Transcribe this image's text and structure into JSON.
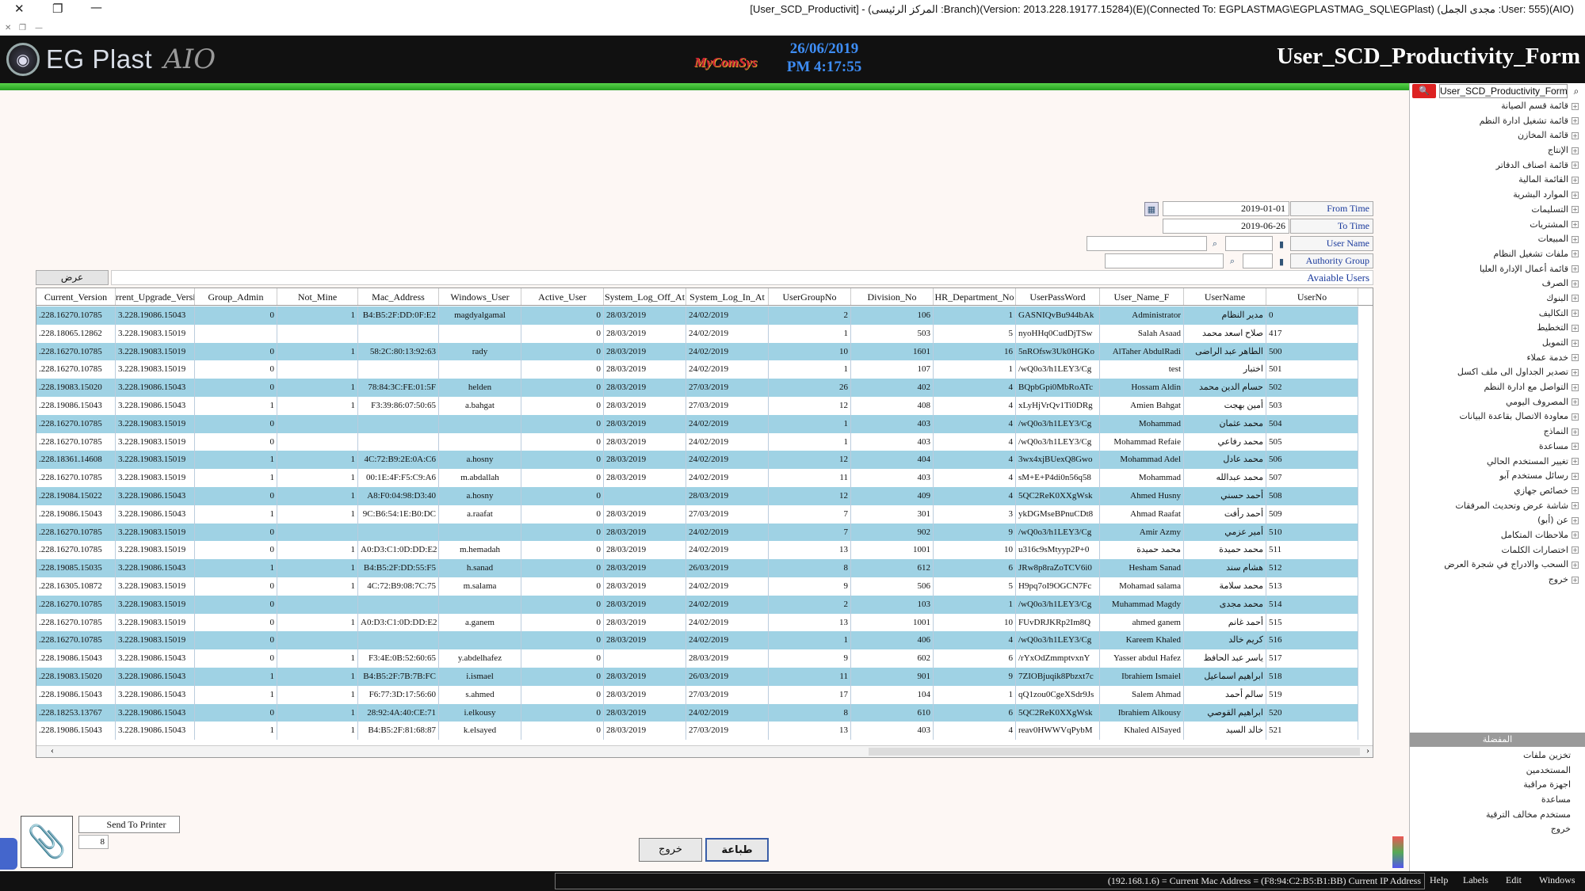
{
  "window": {
    "title": "[User_SCD_Productivit] - (المركز الرئيسى :Branch)(Version: 2013.228.19177.15284)(E)(Connected To: EGPLASTMAG\\EGPLASTMAG_SQL\\EGPlast) (مجدى الجمل :User: 555)(AIO)",
    "close": "✕",
    "restore": "❐",
    "minimize": "—"
  },
  "header": {
    "logo_text": "EG Plast",
    "logo_suffix": "AIO",
    "logo_mark": "◉",
    "brand": "MyComSys",
    "date": "26/06/2019",
    "time": "PM 4:17:55",
    "form_title": "User_SCD_Productivity_Form"
  },
  "filters": {
    "from_label": "From Time",
    "from_value": "2019-01-01",
    "to_label": "To Time",
    "to_value": "2019-06-26",
    "user_label": "User Name",
    "group_label": "Authority Group",
    "available_label": "Avaiable Users",
    "show_button": "عرض"
  },
  "grid": {
    "columns": [
      "Current_Version",
      "rrent_Upgrade_Versi",
      "Group_Admin",
      "Not_Mine",
      "Mac_Address",
      "Windows_User",
      "Active_User",
      "System_Log_Off_At",
      "System_Log_In_At",
      "UserGroupNo",
      "Division_No",
      "HR_Department_No",
      "UserPassWord",
      "User_Name_F",
      "UserName",
      "UserNo"
    ],
    "rows": [
      [
        ".228.16270.10785",
        "3.228.19086.15043",
        "0",
        "1",
        "B4:B5:2F:DD:0F:E2",
        "magdyalgamal",
        "0",
        "28/03/2019",
        "24/02/2019",
        "2",
        "106",
        "1",
        "GASNIQvBu944bAk",
        "Administrator",
        "مدير النظام",
        "0"
      ],
      [
        ".228.18065.12862",
        "3.228.19083.15019",
        "",
        "",
        "",
        "",
        "0",
        "28/03/2019",
        "24/02/2019",
        "1",
        "503",
        "5",
        "nyoHHq0CudDjTSw",
        "Salah Asaad",
        "صلاح اسعد محمد",
        "417"
      ],
      [
        ".228.16270.10785",
        "3.228.19083.15019",
        "0",
        "1",
        "58:2C:80:13:92:63",
        "rady",
        "0",
        "28/03/2019",
        "24/02/2019",
        "10",
        "1601",
        "16",
        "5nROfsw3Uk0HGKo",
        "AlTaher AbdulRadi",
        "الطاهر عبد الراضى",
        "500"
      ],
      [
        ".228.16270.10785",
        "3.228.19083.15019",
        "0",
        "",
        "",
        "",
        "0",
        "28/03/2019",
        "24/02/2019",
        "1",
        "107",
        "1",
        "/wQ0o3/h1LEY3/Cg",
        "test",
        "اختبار",
        "501"
      ],
      [
        ".228.19083.15020",
        "3.228.19086.15043",
        "0",
        "1",
        "78:84:3C:FE:01:5F",
        "helden",
        "0",
        "28/03/2019",
        "27/03/2019",
        "26",
        "402",
        "4",
        "BQpbGpi0MbRoATc",
        "Hossam Aldin",
        "حسام الدين محمد",
        "502"
      ],
      [
        ".228.19086.15043",
        "3.228.19086.15043",
        "1",
        "1",
        "F3:39:86:07:50:65",
        "a.bahgat",
        "0",
        "28/03/2019",
        "27/03/2019",
        "12",
        "408",
        "4",
        "xLyHjVrQv1Ti0DRg",
        "Amien Bahgat",
        "أمين بهجت",
        "503"
      ],
      [
        ".228.16270.10785",
        "3.228.19083.15019",
        "0",
        "",
        "",
        "",
        "0",
        "28/03/2019",
        "24/02/2019",
        "1",
        "403",
        "4",
        "/wQ0o3/h1LEY3/Cg",
        "Mohammad",
        "محمد عثمان",
        "504"
      ],
      [
        ".228.16270.10785",
        "3.228.19083.15019",
        "0",
        "",
        "",
        "",
        "0",
        "28/03/2019",
        "24/02/2019",
        "1",
        "403",
        "4",
        "/wQ0o3/h1LEY3/Cg",
        "Mohammad Refaie",
        "محمد رفاعي",
        "505"
      ],
      [
        ".228.18361.14608",
        "3.228.19083.15019",
        "1",
        "1",
        "4C:72:B9:2E:0A:C6",
        "a.hosny",
        "0",
        "28/03/2019",
        "24/02/2019",
        "12",
        "404",
        "4",
        "3wx4xjBUexQ8Gwo",
        "Mohammad Adel",
        "محمد عادل",
        "506"
      ],
      [
        ".228.16270.10785",
        "3.228.19083.15019",
        "1",
        "1",
        "00:1E:4F:F5:C9:A6",
        "m.abdallah",
        "0",
        "28/03/2019",
        "24/02/2019",
        "11",
        "403",
        "4",
        "sM+E+P4di0n56q58",
        "Mohammad",
        "محمد عبدالله",
        "507"
      ],
      [
        ".228.19084.15022",
        "3.228.19086.15043",
        "0",
        "1",
        "A8:F0:04:98:D3:40",
        "a.hosny",
        "0",
        "",
        "28/03/2019",
        "12",
        "409",
        "4",
        "5QC2ReK0XXgWsk",
        "Ahmed Husny",
        "أحمد حسني",
        "508"
      ],
      [
        ".228.19086.15043",
        "3.228.19086.15043",
        "1",
        "1",
        "9C:B6:54:1E:B0:DC",
        "a.raafat",
        "0",
        "28/03/2019",
        "27/03/2019",
        "7",
        "301",
        "3",
        "ykDGMseBPnuCDt8",
        "Ahmad Raafat",
        "أحمد رأفت",
        "509"
      ],
      [
        ".228.16270.10785",
        "3.228.19083.15019",
        "0",
        "",
        "",
        "",
        "0",
        "28/03/2019",
        "24/02/2019",
        "7",
        "902",
        "9",
        "/wQ0o3/h1LEY3/Cg",
        "Amir Azmy",
        "أمير عزمي",
        "510"
      ],
      [
        ".228.16270.10785",
        "3.228.19083.15019",
        "0",
        "1",
        "A0:D3:C1:0D:DD:E2",
        "m.hemadah",
        "0",
        "28/03/2019",
        "24/02/2019",
        "13",
        "1001",
        "10",
        "u316c9sMtyyp2P+0",
        "محمد حميدة",
        "محمد حميدة",
        "511"
      ],
      [
        ".228.19085.15035",
        "3.228.19086.15043",
        "1",
        "1",
        "B4:B5:2F:DD:55:F5",
        "h.sanad",
        "0",
        "28/03/2019",
        "26/03/2019",
        "8",
        "612",
        "6",
        "JRw8p8raZoTCV6i0",
        "Hesham Sanad",
        "هشام سند",
        "512"
      ],
      [
        ".228.16305.10872",
        "3.228.19083.15019",
        "0",
        "1",
        "4C:72:B9:08:7C:75",
        "m.salama",
        "0",
        "28/03/2019",
        "24/02/2019",
        "9",
        "506",
        "5",
        "H9pq7oI9OGCN7Fc",
        "Mohamad salama",
        "محمد سلامة",
        "513"
      ],
      [
        ".228.16270.10785",
        "3.228.19083.15019",
        "0",
        "",
        "",
        "",
        "0",
        "28/03/2019",
        "24/02/2019",
        "2",
        "103",
        "1",
        "/wQ0o3/h1LEY3/Cg",
        "Muhammad Magdy",
        "محمد مجدى",
        "514"
      ],
      [
        ".228.16270.10785",
        "3.228.19083.15019",
        "0",
        "1",
        "A0:D3:C1:0D:DD:E2",
        "a.ganem",
        "0",
        "28/03/2019",
        "24/02/2019",
        "13",
        "1001",
        "10",
        "FUvDRJKRp2Im8Q",
        "ahmed ganem",
        "أحمد غانم",
        "515"
      ],
      [
        ".228.16270.10785",
        "3.228.19083.15019",
        "0",
        "",
        "",
        "",
        "0",
        "28/03/2019",
        "24/02/2019",
        "1",
        "406",
        "4",
        "/wQ0o3/h1LEY3/Cg",
        "Kareem Khaled",
        "كريم خالد",
        "516"
      ],
      [
        ".228.19086.15043",
        "3.228.19086.15043",
        "0",
        "1",
        "F3:4E:0B:52:60:65",
        "y.abdelhafez",
        "0",
        "",
        "28/03/2019",
        "9",
        "602",
        "6",
        "/rYxOdZmmptvxnY",
        "Yasser abdul Hafez",
        "ياسر عبد الحافظ",
        "517"
      ],
      [
        ".228.19083.15020",
        "3.228.19086.15043",
        "1",
        "1",
        "B4:B5:2F:7B:7B:FC",
        "i.ismael",
        "0",
        "28/03/2019",
        "26/03/2019",
        "11",
        "901",
        "9",
        "7ZIOBjuqik8Pbzxt7c",
        "Ibrahiem Ismaiel",
        "ابراهيم اسماعيل",
        "518"
      ],
      [
        ".228.19086.15043",
        "3.228.19086.15043",
        "1",
        "1",
        "F6:77:3D:17:56:60",
        "s.ahmed",
        "0",
        "28/03/2019",
        "27/03/2019",
        "17",
        "104",
        "1",
        "qQ1zou0CgeXSdr9Js",
        "Salem Ahmad",
        "سالم أحمد",
        "519"
      ],
      [
        ".228.18253.13767",
        "3.228.19086.15043",
        "0",
        "1",
        "28:92:4A:40:CE:71",
        "i.elkousy",
        "0",
        "28/03/2019",
        "24/02/2019",
        "8",
        "610",
        "6",
        "5QC2ReK0XXgWsk",
        "Ibrahiem Alkousy",
        "ابراهيم القوصي",
        "520"
      ],
      [
        ".228.19086.15043",
        "3.228.19086.15043",
        "1",
        "1",
        "B4:B5:2F:81:68:87",
        "k.elsayed",
        "0",
        "28/03/2019",
        "27/03/2019",
        "13",
        "403",
        "4",
        "reav0HWWVqPybM",
        "Khaled AlSayed",
        "خالد السيد",
        "521"
      ]
    ]
  },
  "printer": {
    "clip_icon": "📎",
    "send_label": "Send To Printer",
    "copies": "8"
  },
  "buttons": {
    "exit": "خروج",
    "print": "طباعة"
  },
  "status": {
    "ip_text": "(192.168.1.6) = Current Mac Address = (F8:94:C2:B5:B1:BB) Current IP Address",
    "menus": [
      "Help",
      "Labels",
      "Edit",
      "Windows"
    ]
  },
  "side": {
    "search_value": "User_SCD_Productivity_Form",
    "tree": [
      "قائمة قسم الصيانة",
      "قائمة تشغيل ادارة النظم",
      "قائمة المخازن",
      "الإنتاج",
      "قائمة اصناف الدفاتر",
      "القائمة المالية",
      "الموارد البشرية",
      "التسليمات",
      "المشتريات",
      "المبيعات",
      "ملفات تشغيل النظام",
      "قائمة أعمال الإدارة العليا",
      "الصرف",
      "البنوك",
      "التكاليف",
      "التخطيط",
      "التمويل",
      "خدمة عملاء",
      "تصدير الجداول الى ملف اكسل",
      "التواصل مع ادارة النظم",
      "المصروف اليومي",
      "معاودة الاتصال بقاعدة البيانات",
      "النماذج",
      "مساعدة",
      "تغيير المستخدم الحالي",
      "رسائل مستخدم آبو",
      "خصائص جهازي",
      "شاشة عرض وتحديث المرفقات",
      "عن (أبو)",
      "ملاحظات المتكامل",
      "اختصارات الكلمات",
      "السحب والادراج في شجرة العرض",
      "خروج"
    ],
    "fav_header": "المفضلة",
    "favorites": [
      "تخزين ملفات",
      "المستخدمين",
      "اجهزة مراقبة",
      "مساعدة",
      "مستخدم مخالف الترقية",
      "خروج"
    ]
  }
}
